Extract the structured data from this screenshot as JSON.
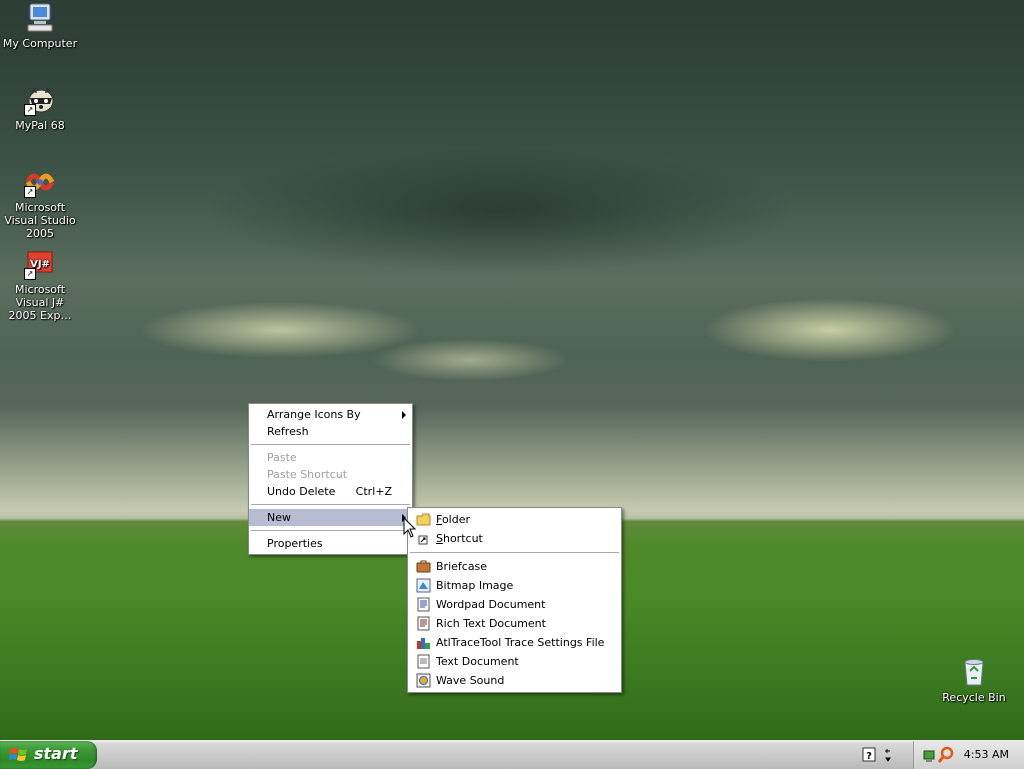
{
  "desktop_icons": [
    {
      "label": "My Computer",
      "icon": "my-computer-icon"
    },
    {
      "label": "MyPal 68",
      "icon": "mypal-icon"
    },
    {
      "label": "Microsoft Visual Studio 2005",
      "icon": "visual-studio-icon"
    },
    {
      "label": "Microsoft Visual J# 2005 Exp…",
      "icon": "vjsharp-icon"
    },
    {
      "label": "Recycle Bin",
      "icon": "recycle-bin-icon"
    }
  ],
  "context_menu": {
    "arrange_icons_by": "Arrange Icons By",
    "refresh": "Refresh",
    "paste": "Paste",
    "paste_shortcut": "Paste Shortcut",
    "undo_delete": "Undo Delete",
    "undo_delete_shortcut": "Ctrl+Z",
    "new": "New",
    "properties": "Properties"
  },
  "new_submenu": {
    "folder_pre": "",
    "folder_u": "F",
    "folder_post": "older",
    "shortcut_pre": "",
    "shortcut_u": "S",
    "shortcut_post": "hortcut",
    "items": [
      {
        "label": "Briefcase",
        "icon": "briefcase-icon"
      },
      {
        "label": "Bitmap Image",
        "icon": "bitmap-icon"
      },
      {
        "label": "Wordpad Document",
        "icon": "wordpad-icon"
      },
      {
        "label": "Rich Text Document",
        "icon": "rtf-icon"
      },
      {
        "label": "AtlTraceTool Trace Settings File",
        "icon": "trace-settings-icon"
      },
      {
        "label": "Text Document",
        "icon": "text-document-icon"
      },
      {
        "label": "Wave Sound",
        "icon": "wave-sound-icon"
      }
    ]
  },
  "taskbar": {
    "start_label": "start",
    "clock": "4:53 AM"
  }
}
